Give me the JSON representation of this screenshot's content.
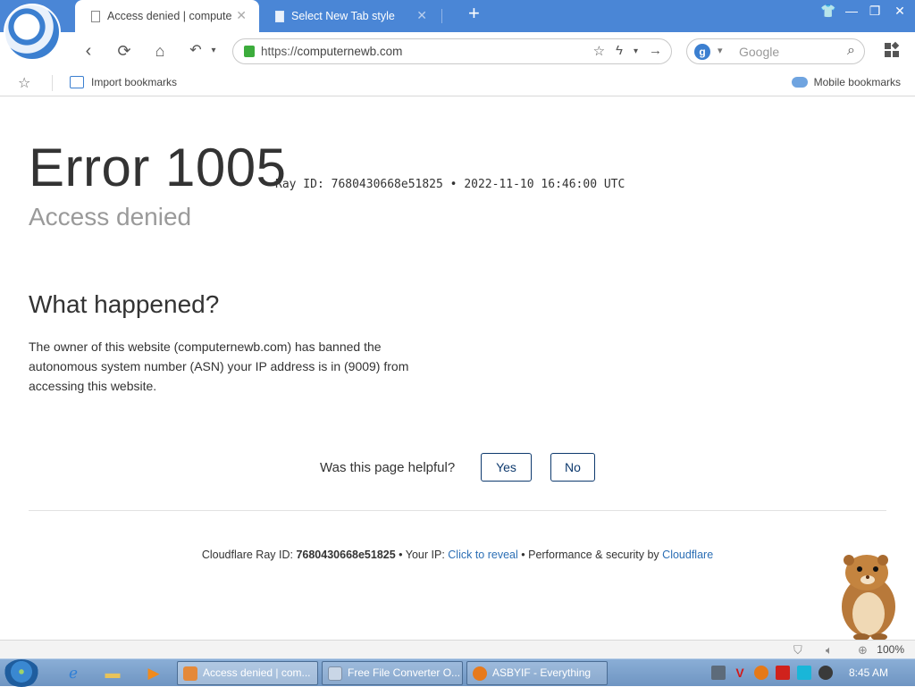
{
  "browser": {
    "tabs": [
      {
        "label": "Access denied | computernewb.com"
      },
      {
        "label": "Select New Tab style"
      }
    ],
    "url_scheme": "https://",
    "url_host": "computernewb.com",
    "search_placeholder": "Google",
    "search_engine_icon": "g",
    "bookmarks": {
      "import_label": "Import bookmarks",
      "mobile_label": "Mobile bookmarks"
    },
    "zoom": "100%"
  },
  "page": {
    "error_title": "Error 1005",
    "ray_line": "Ray ID: 7680430668e51825 • 2022-11-10 16:46:00 UTC",
    "subtitle": "Access denied",
    "heading": "What happened?",
    "paragraph": "The owner of this website (computernewb.com) has banned the autonomous system number (ASN) your IP address is in (9009) from accessing this website.",
    "helpful_label": "Was this page helpful?",
    "yes_label": "Yes",
    "no_label": "No",
    "footer": {
      "ray_prefix": "Cloudflare Ray ID: ",
      "ray_id": "7680430668e51825",
      "ip_prefix": " • Your IP: ",
      "ip_link": "Click to reveal",
      "perf_prefix": " • Performance & security by ",
      "perf_link": "Cloudflare"
    }
  },
  "taskbar": {
    "tasks": [
      {
        "label": "Access denied | com..."
      },
      {
        "label": "Free File Converter O..."
      },
      {
        "label": "ASBYIF - Everything"
      }
    ],
    "clock": "8:45 AM"
  }
}
